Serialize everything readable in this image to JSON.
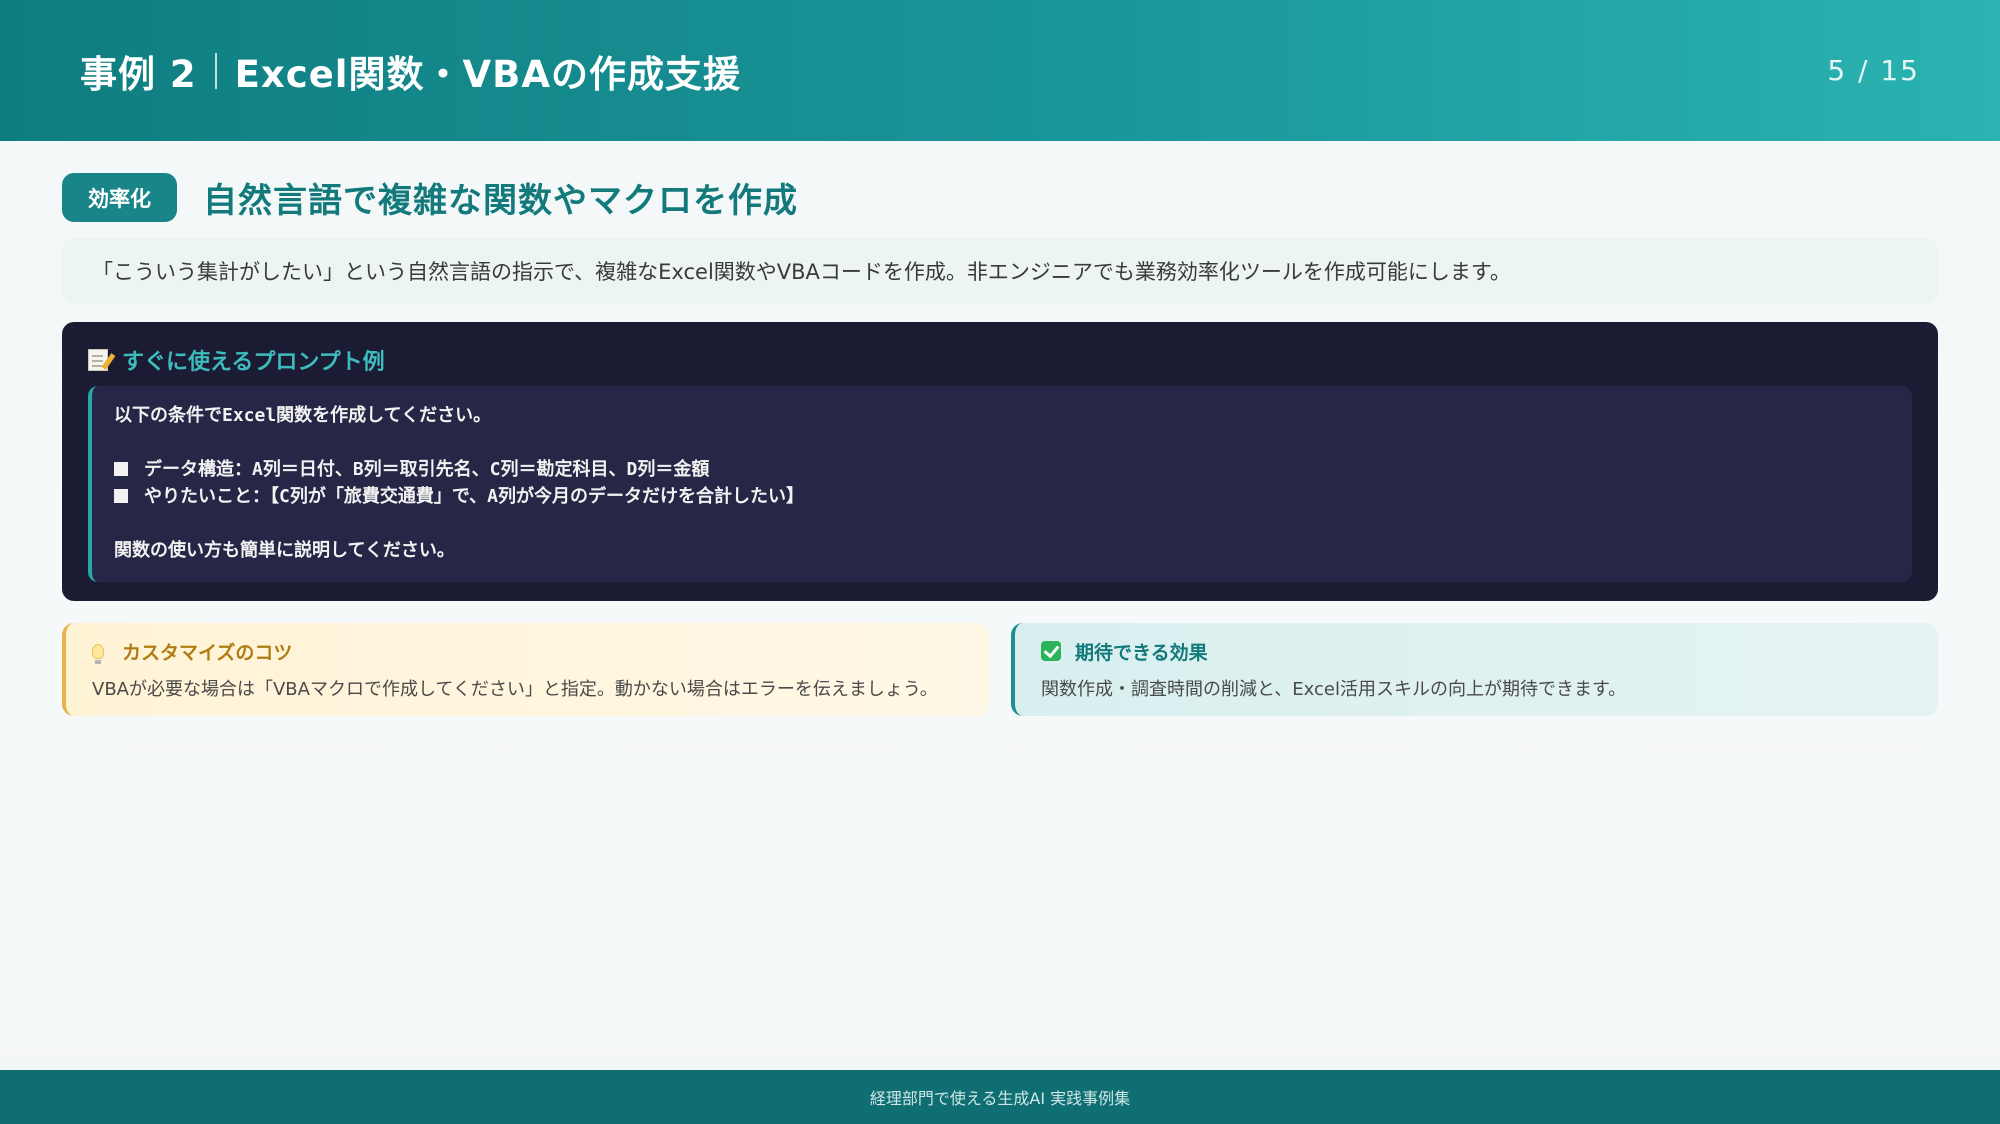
{
  "header": {
    "case_label": "事例 2",
    "title": "Excel関数・VBAの作成支援",
    "page": "5 / 15"
  },
  "section": {
    "badge": "効率化",
    "title": "自然言語で複雑な関数やマクロを作成"
  },
  "description": "「こういう集計がしたい」という自然言語の指示で、複雑なExcel関数やVBAコードを作成。非エンジニアでも業務効率化ツールを作成可能にします。",
  "prompt": {
    "icon": "memo-icon",
    "label": "すぐに使えるプロンプト例",
    "lines": [
      "以下の条件でExcel関数を作成してください。",
      "",
      "データ構造：A列＝日付、B列＝取引先名、C列＝勘定科目、D列＝金額",
      "やりたいこと：【C列が「旅費交通費」で、A列が今月のデータだけを合計したい】",
      "",
      "関数の使い方も簡単に説明してください。"
    ]
  },
  "tips": {
    "left": {
      "icon": "bulb-icon",
      "title": "カスタマイズのコツ",
      "text": "VBAが必要な場合は「VBAマクロで作成してください」と指定。動かない場合はエラーを伝えましょう。"
    },
    "right": {
      "icon": "check-icon",
      "title": "期待できる効果",
      "text": "関数作成・調査時間の削減と、Excel活用スキルの向上が期待できます。"
    }
  },
  "footer": "経理部門で使える生成AI 実践事例集",
  "colors": {
    "accent": "#1a8589",
    "dark_card": "#1b1c33",
    "tip_warm": "#fff3d6",
    "tip_cool": "#d9efef"
  }
}
